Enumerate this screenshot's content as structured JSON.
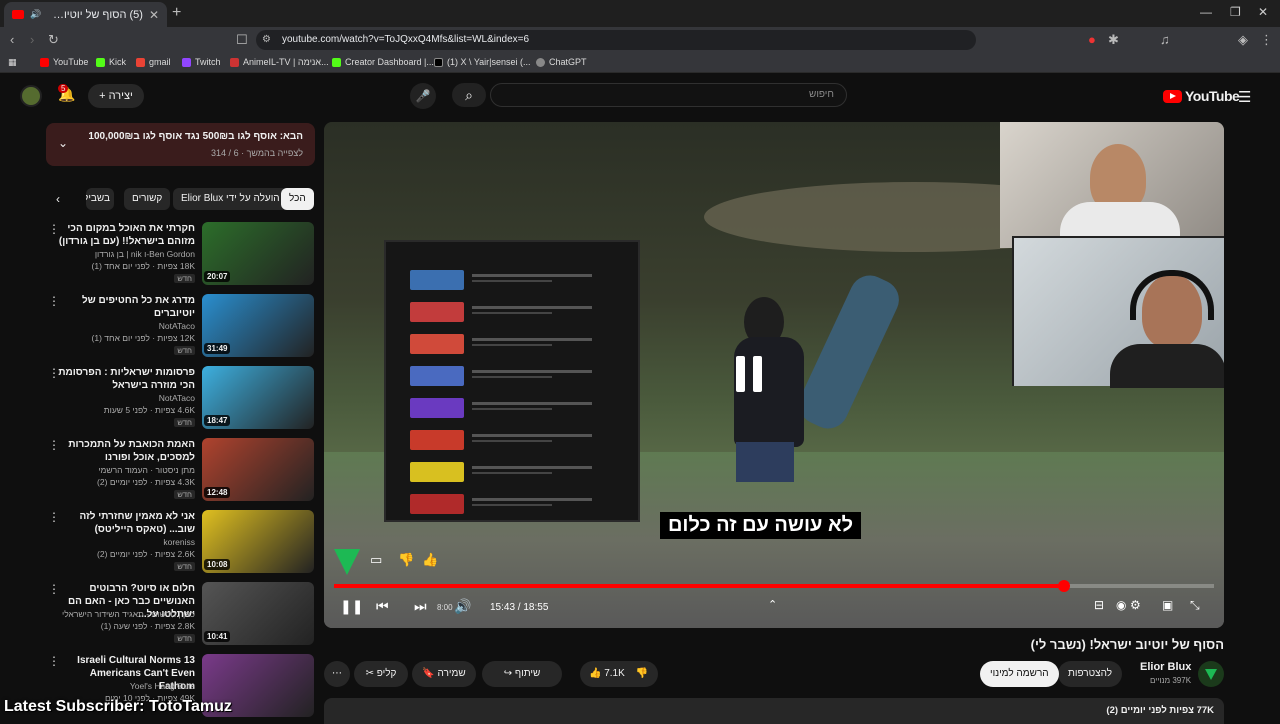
{
  "browser": {
    "tab_title": "(5) הסוף של יוטיוב ישראל! (נ...",
    "url": "youtube.com/watch?v=ToJQxxQ4Mfs&list=WL&index=6",
    "bookmarks": [
      {
        "label": "YouTube",
        "color": "#ff0000"
      },
      {
        "label": "Kick",
        "color": "#53fc18"
      },
      {
        "label": "gmail",
        "color": "#ea4335"
      },
      {
        "label": "Twitch",
        "color": "#9146ff"
      },
      {
        "label": "AnimeIL-TV | אנימה...",
        "color": "#cc3333"
      },
      {
        "label": "Creator Dashboard |...",
        "color": "#53fc18"
      },
      {
        "label": "(1) X \\ Yair|sensei (...",
        "color": "#000000"
      },
      {
        "label": "ChatGPT",
        "color": "#888888"
      }
    ]
  },
  "header": {
    "search_placeholder": "חיפוש",
    "create_label": "יצירה",
    "bell_count": "5",
    "logo": "YouTube"
  },
  "playlist": {
    "title": "הבא: אוסף לגו ב500₪ נגד אוסף לגו ב100,000₪",
    "subtitle": "לצפייה בהמשך · 6 / 314"
  },
  "chips": [
    "הכל",
    "הועלה על ידי Elior Blux",
    "קשורים",
    "בשביל"
  ],
  "videos": [
    {
      "title": "חקרתי את האוכל במקום הכי מזוהם בישראל!! (עם בן גורדון)",
      "channel": "Ben Gordon-ו nik | בן גורדון",
      "meta": "18K צפיות · לפני יום אחד (1)",
      "badge": "חדש",
      "duration": "20:07",
      "thumb": "#2c6e2a"
    },
    {
      "title": "מדרג את כל החטיפים של יוטיוברים",
      "channel": "NotATaco",
      "meta": "12K צפיות · לפני יום אחד (1)",
      "badge": "חדש",
      "duration": "31:49",
      "thumb": "#2a8fd0"
    },
    {
      "title": "פרסומות ישראליות : הפרסומת הכי מוזרה בישראל",
      "channel": "NotATaco",
      "meta": "4.6K צפיות · לפני 5 שעות",
      "badge": "חדש",
      "duration": "18:47",
      "thumb": "#3db0e0"
    },
    {
      "title": "האמת הכואבת על התמכרות למסכים, אוכל ופורנו",
      "channel": "מתן ניסטור · העמוד הרשמי",
      "meta": "4.3K צפיות · לפני יומיים (2)",
      "badge": "חדש",
      "duration": "12:48",
      "thumb": "#b0432e"
    },
    {
      "title": "אני לא מאמין שחזרתי לזה שוב... (טאקס הייליטס)",
      "channel": "koreniss",
      "meta": "2.6K צפיות · לפני יומיים (2)",
      "badge": "חדש",
      "duration": "10:08",
      "thumb": "#e0c020"
    },
    {
      "title": "חלום או סיוט? הרבוטים האנושיים כבר כאן - האם הם ישתלטו על...",
      "channel": "כאן | חדשות - תאגיד השידור הישראלי",
      "meta": "2.8K צפיות · לפני שעה (1)",
      "badge": "חדש",
      "duration": "10:41",
      "thumb": "#555555"
    },
    {
      "title": "13 Israeli Cultural Norms Americans Can't Even Fathom",
      "channel": "Yoel's Hang Outs",
      "meta": "49K צפיות · לפני 10 ימים",
      "badge": "",
      "duration": "",
      "thumb": "#7a3a8a"
    }
  ],
  "player": {
    "subtitle_text": "לא עושה עם זה כלום",
    "time": "15:43 / 18:55",
    "volume_label": "8:00",
    "progress": 0.83
  },
  "below": {
    "title": "הסוף של יוטיוב ישראל! (נשבר לי)",
    "channel_name": "Elior Blux",
    "subscribers": "397K מנויים",
    "join_label": "להצטרפות",
    "subscribe_label": "הרשמה למינוי",
    "likes": "7.1K",
    "share_label": "שיתוף",
    "save_label": "שמירה",
    "clip_label": "קליפ",
    "description": "77K צפיות  לפני יומיים (2)"
  },
  "overlay_text": "Latest Subscriber: TotoTamuz"
}
